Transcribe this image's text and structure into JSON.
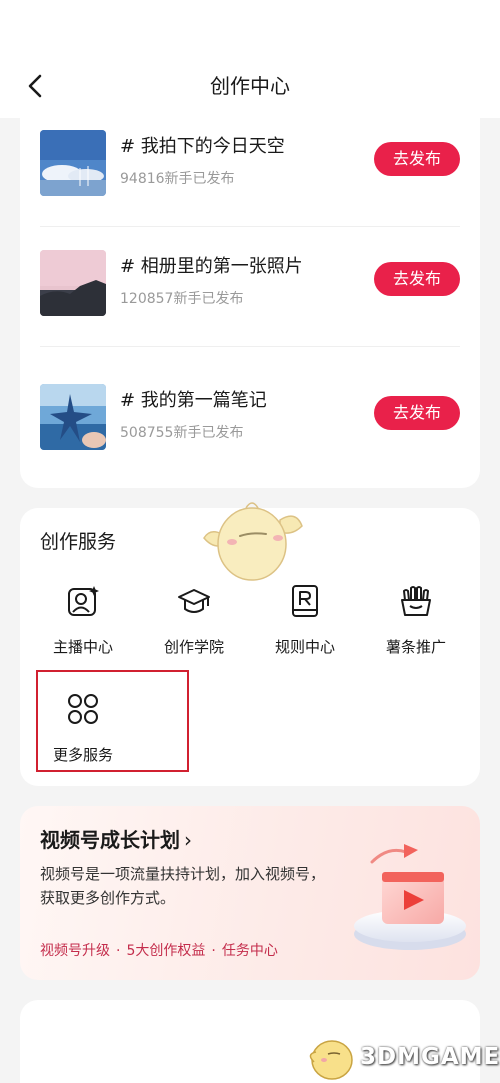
{
  "header": {
    "title": "创作中心"
  },
  "topics": [
    {
      "name": "# 我拍下的今日天空",
      "count": "94816新手已发布",
      "action": "去发布"
    },
    {
      "name": "# 相册里的第一张照片",
      "count": "120857新手已发布",
      "action": "去发布"
    },
    {
      "name": "# 我的第一篇笔记",
      "count": "508755新手已发布",
      "action": "去发布"
    }
  ],
  "services": {
    "title": "创作服务",
    "items": [
      {
        "label": "主播中心",
        "icon": "anchor-center-icon"
      },
      {
        "label": "创作学院",
        "icon": "graduation-cap-icon"
      },
      {
        "label": "规则中心",
        "icon": "rules-book-icon"
      },
      {
        "label": "薯条推广",
        "icon": "fries-icon"
      },
      {
        "label": "更多服务",
        "icon": "more-grid-icon"
      }
    ]
  },
  "plan": {
    "title": "视频号成长计划",
    "chevron": "›",
    "description": "视频号是一项流量扶持计划，加入视频号，获取更多创作方式。",
    "links": [
      "视频号升级",
      "5大创作权益",
      "任务中心"
    ],
    "separator": "·"
  },
  "watermark": {
    "text": "3DMGAME"
  },
  "colors": {
    "accent": "#e9214a",
    "link": "#c42d4c",
    "highlight": "#d12030"
  }
}
